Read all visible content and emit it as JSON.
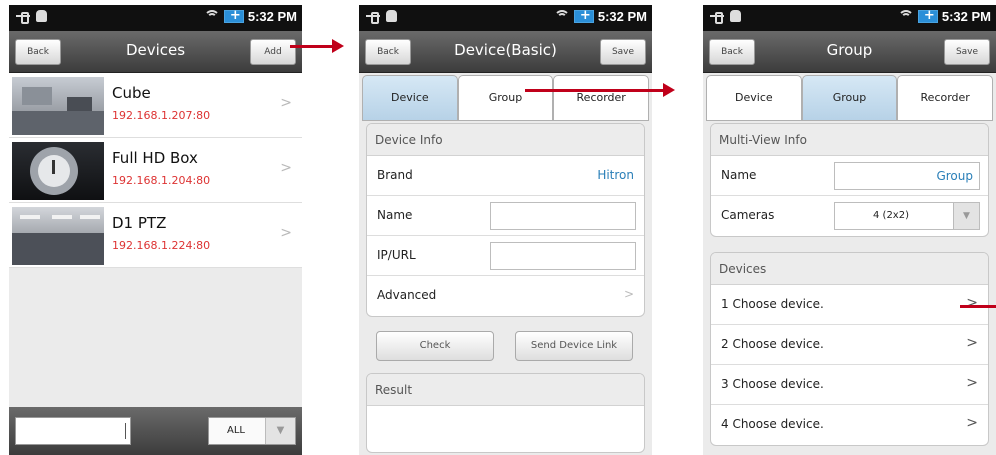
{
  "status": {
    "time": "5:32 PM"
  },
  "screen1": {
    "back_label": "Back",
    "title": "Devices",
    "add_label": "Add",
    "devices": [
      {
        "name": "Cube",
        "address": "192.168.1.207:80"
      },
      {
        "name": "Full HD Box",
        "address": "192.168.1.204:80"
      },
      {
        "name": "D1 PTZ",
        "address": "192.168.1.224:80"
      }
    ],
    "search_value": "",
    "filter_value": "ALL"
  },
  "screen2": {
    "back_label": "Back",
    "title": "Device(Basic)",
    "save_label": "Save",
    "tabs": [
      "Device",
      "Group",
      "Recorder"
    ],
    "device_info_header": "Device Info",
    "brand_label": "Brand",
    "brand_value": "Hitron",
    "name_label": "Name",
    "ipurl_label": "IP/URL",
    "advanced_label": "Advanced",
    "check_label": "Check",
    "send_link_label": "Send Device Link",
    "result_header": "Result"
  },
  "screen3": {
    "back_label": "Back",
    "title": "Group",
    "save_label": "Save",
    "tabs": [
      "Device",
      "Group",
      "Recorder"
    ],
    "multiview_header": "Multi-View Info",
    "name_label": "Name",
    "name_value": "Group",
    "cameras_label": "Cameras",
    "cameras_value": "4 (2x2)",
    "devices_header": "Devices",
    "device_slots": [
      "1  Choose device.",
      "2  Choose device.",
      "3  Choose device.",
      "4  Choose device."
    ]
  },
  "colors": {
    "accent_red": "#c0001a",
    "ip_red": "#d33333",
    "tab_active": "#c7dcee"
  }
}
